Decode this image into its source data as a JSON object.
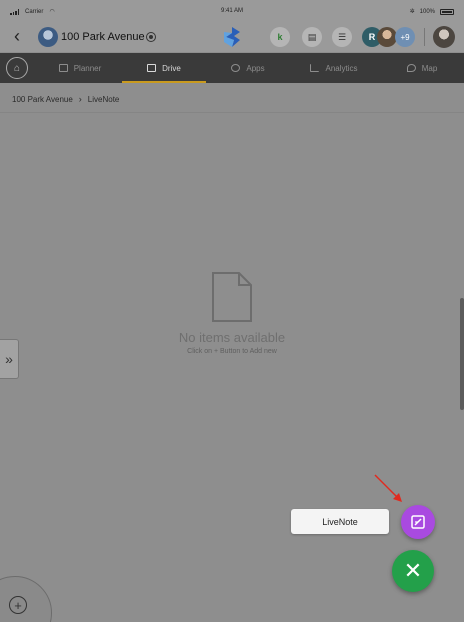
{
  "status_bar": {
    "carrier": "Carrier",
    "time": "9:41 AM",
    "battery": "100%"
  },
  "header": {
    "project_name": "100 Park Avenue",
    "more_members": "+9",
    "member_initial": "R"
  },
  "nav": {
    "tabs": [
      {
        "label": "Planner",
        "icon": "planner-icon"
      },
      {
        "label": "Drive",
        "icon": "drive-icon",
        "active": true
      },
      {
        "label": "Apps",
        "icon": "apps-icon"
      },
      {
        "label": "Analytics",
        "icon": "analytics-icon"
      },
      {
        "label": "Map",
        "icon": "map-icon"
      }
    ]
  },
  "breadcrumb": {
    "root": "100 Park Avenue",
    "current": "LiveNote"
  },
  "empty_state": {
    "title": "No items available",
    "subtitle": "Click on + Button to Add new"
  },
  "fab_menu": {
    "livenote_label": "LiveNote"
  },
  "colors": {
    "active_tab_underline": "#c99a1e",
    "fab_primary": "#23a04a",
    "fab_livenote": "#a94ae0",
    "annotation_arrow": "#e02a1f"
  }
}
